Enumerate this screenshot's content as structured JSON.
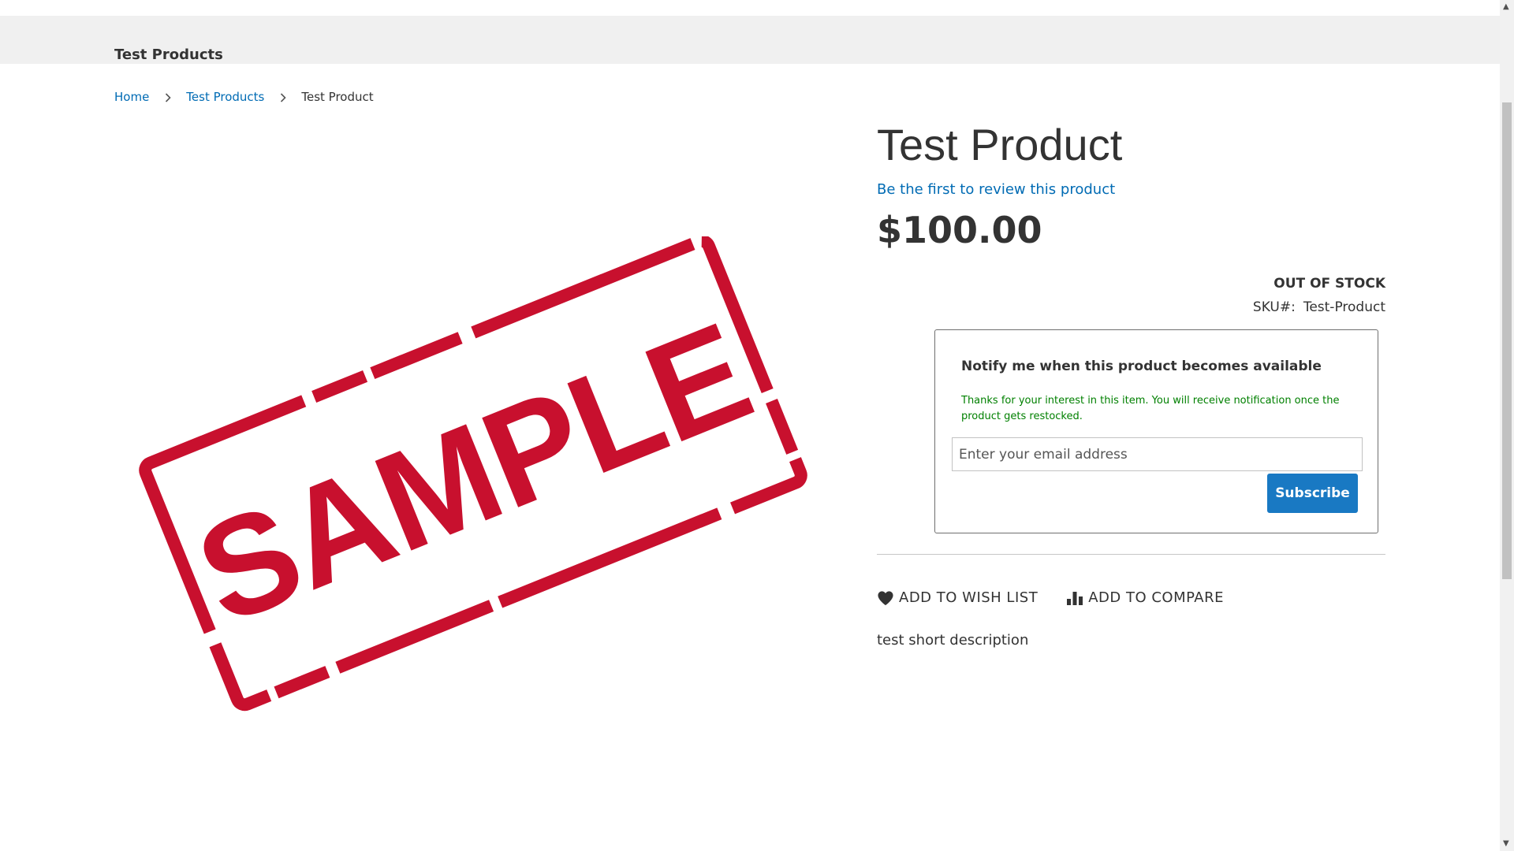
{
  "navigation": {
    "category": "Test Products"
  },
  "breadcrumb": {
    "home": "Home",
    "category": "Test Products",
    "current": "Test Product"
  },
  "product": {
    "title": "Test Product",
    "review_link": "Be the first to review this product",
    "price": "$100.00",
    "stock_status": "OUT OF STOCK",
    "sku_label": "SKU#:",
    "sku_value": "Test-Product",
    "short_description": "test short description",
    "image": {
      "stamp_text": "SAMPLE",
      "stamp_color": "#c8102e"
    }
  },
  "notify": {
    "title": "Notify me when this product becomes available",
    "message": "Thanks for your interest in this item. You will receive notification once the product gets restocked.",
    "email_placeholder": "Enter your email address",
    "subscribe_label": "Subscribe"
  },
  "actions": {
    "wishlist_label": "ADD TO WISH LIST",
    "wishlist_icon": "heart-icon",
    "compare_label": "ADD TO COMPARE",
    "compare_icon": "bar-chart-icon"
  },
  "colors": {
    "link": "#006bb4",
    "button": "#1979c3",
    "success_text": "#008000"
  }
}
